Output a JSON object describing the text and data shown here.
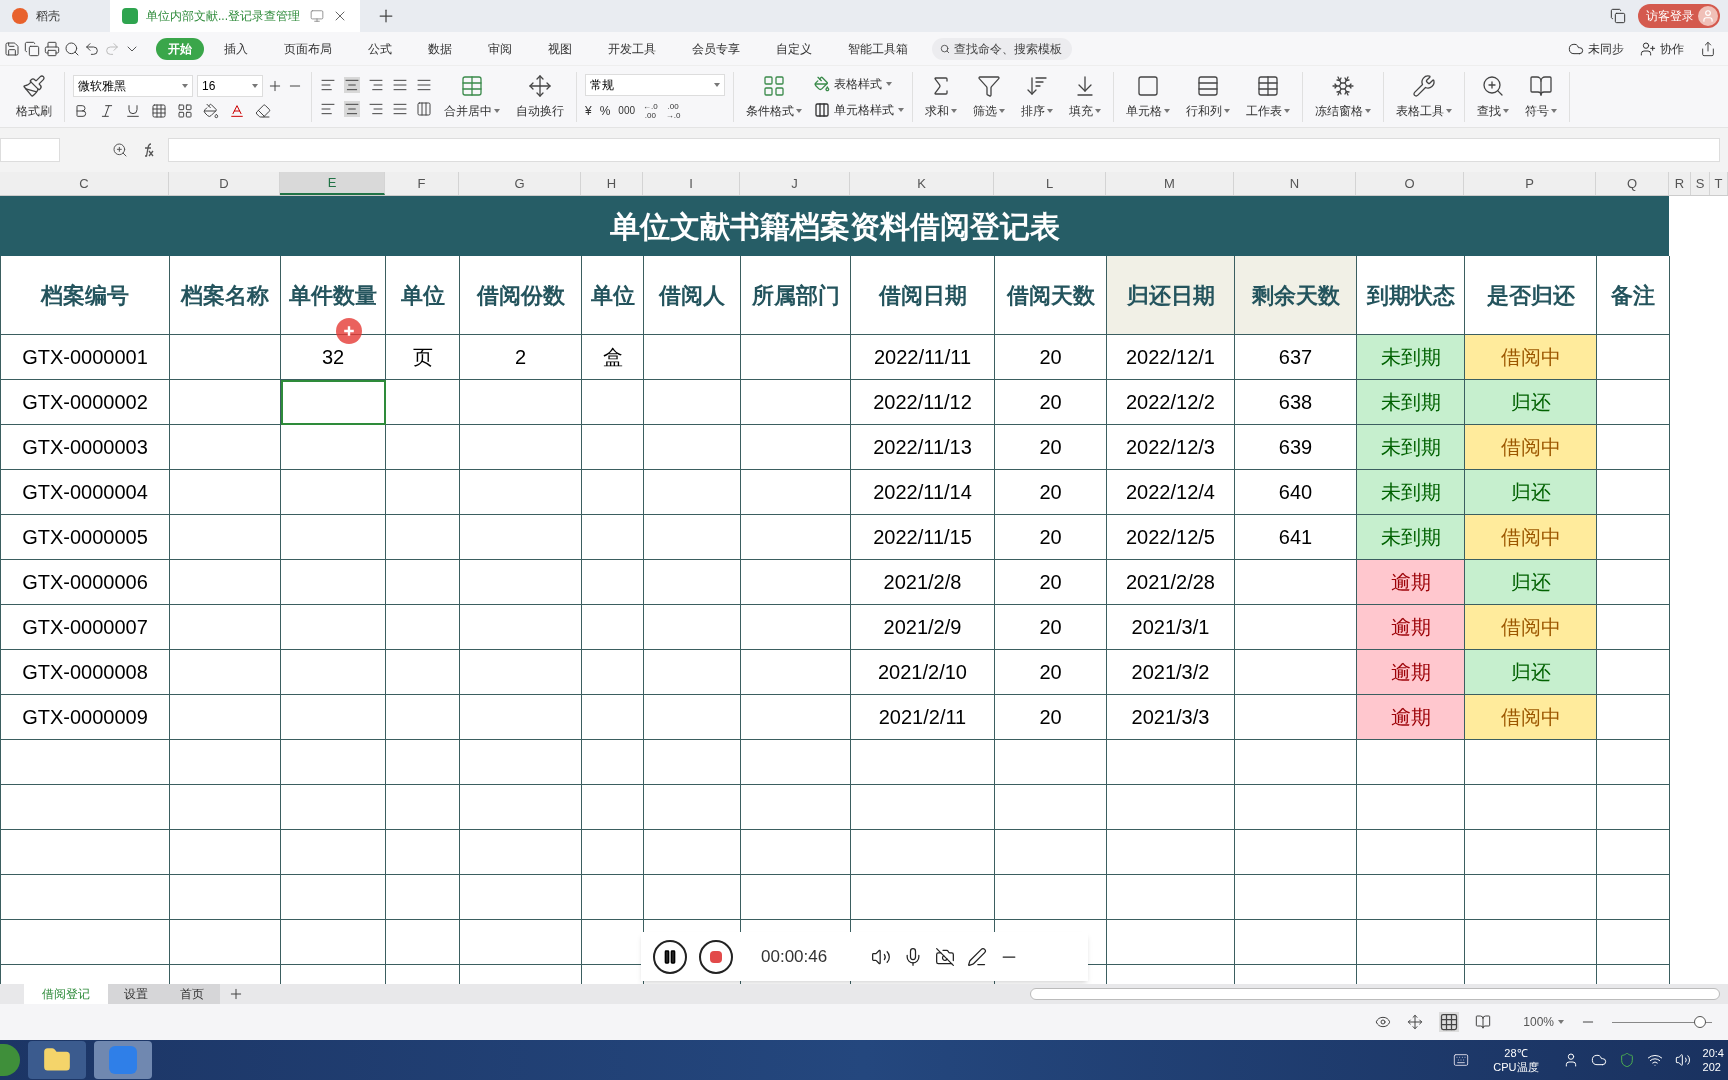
{
  "tabs": [
    {
      "label": "稻壳",
      "selected": false
    },
    {
      "label": "单位内部文献...登记录查管理",
      "selected": true
    }
  ],
  "account": {
    "label": "访客登录"
  },
  "menu": [
    {
      "label": "开始",
      "selected": true
    },
    {
      "label": "插入",
      "selected": false
    },
    {
      "label": "页面布局",
      "selected": false
    },
    {
      "label": "公式",
      "selected": false
    },
    {
      "label": "数据",
      "selected": false
    },
    {
      "label": "审阅",
      "selected": false
    },
    {
      "label": "视图",
      "selected": false
    },
    {
      "label": "开发工具",
      "selected": false
    },
    {
      "label": "会员专享",
      "selected": false
    },
    {
      "label": "自定义",
      "selected": false
    },
    {
      "label": "智能工具箱",
      "selected": false
    }
  ],
  "search": {
    "placeholder": "查找命令、搜索模板"
  },
  "menu_right": [
    "未同步",
    "协作"
  ],
  "toolbar": {
    "format_painter": "格式刷",
    "font": "微软雅黑",
    "font_size": "16",
    "merge": "合并居中",
    "wrap": "自动换行",
    "number_format": "常规",
    "currency": "¥",
    "percent": "%",
    "thousands": "000",
    "decimal_more": [
      "←.0",
      ".00"
    ],
    "decimal_less": [
      ".00",
      "→.0"
    ],
    "conditional": "条件格式",
    "styles": [
      "表格样式",
      "单元格样式"
    ],
    "large": [
      "求和",
      "筛选",
      "排序",
      "填充",
      "单元格",
      "行和列",
      "工作表",
      "冻结窗格",
      "表格工具",
      "查找",
      "符号"
    ]
  },
  "columns": [
    {
      "label": "C",
      "selected": false
    },
    {
      "label": "D",
      "selected": false
    },
    {
      "label": "E",
      "selected": true
    },
    {
      "label": "F",
      "selected": false
    },
    {
      "label": "G",
      "selected": false
    },
    {
      "label": "H",
      "selected": false
    },
    {
      "label": "I",
      "selected": false
    },
    {
      "label": "J",
      "selected": false
    },
    {
      "label": "K",
      "selected": false
    },
    {
      "label": "L",
      "selected": false
    },
    {
      "label": "M",
      "selected": false
    },
    {
      "label": "N",
      "selected": false
    },
    {
      "label": "O",
      "selected": false
    },
    {
      "label": "P",
      "selected": false
    },
    {
      "label": "Q",
      "selected": false
    },
    {
      "label": "R",
      "selected": false
    },
    {
      "label": "S",
      "selected": false
    },
    {
      "label": "T",
      "selected": false
    }
  ],
  "sheet_title": "单位文献书籍档案资料借阅登记表",
  "headers": [
    {
      "label": "档案编号",
      "shaded": false
    },
    {
      "label": "档案名称",
      "shaded": false
    },
    {
      "label": "单件数量",
      "shaded": false
    },
    {
      "label": "单位",
      "shaded": false
    },
    {
      "label": "借阅份数",
      "shaded": false
    },
    {
      "label": "单位",
      "shaded": false
    },
    {
      "label": "借阅人",
      "shaded": false
    },
    {
      "label": "所属部门",
      "shaded": false
    },
    {
      "label": "借阅日期",
      "shaded": false
    },
    {
      "label": "借阅天数",
      "shaded": false
    },
    {
      "label": "归还日期",
      "shaded": true
    },
    {
      "label": "剩余天数",
      "shaded": true
    },
    {
      "label": "到期状态",
      "shaded": false
    },
    {
      "label": "是否归还",
      "shaded": false
    },
    {
      "label": "备注",
      "shaded": false
    }
  ],
  "rows": [
    {
      "id": "GTX-0000001",
      "quantity": "32",
      "unit": "页",
      "copies": "2",
      "package": "盒",
      "borrow_date": "2022/11/11",
      "days": "20",
      "return_date": "2022/12/1",
      "remaining_days": "637",
      "due_status": {
        "text": "未到期",
        "kind": "not_due"
      },
      "return_status": {
        "text": "借阅中",
        "kind": "borrowing"
      },
      "quantity_selected": false
    },
    {
      "id": "GTX-0000002",
      "borrow_date": "2022/11/12",
      "days": "20",
      "return_date": "2022/12/2",
      "remaining_days": "638",
      "due_status": {
        "text": "未到期",
        "kind": "not_due"
      },
      "return_status": {
        "text": "归还",
        "kind": "returned"
      },
      "quantity_selected": true
    },
    {
      "id": "GTX-0000003",
      "borrow_date": "2022/11/13",
      "days": "20",
      "return_date": "2022/12/3",
      "remaining_days": "639",
      "due_status": {
        "text": "未到期",
        "kind": "not_due"
      },
      "return_status": {
        "text": "借阅中",
        "kind": "borrowing"
      },
      "quantity_selected": false
    },
    {
      "id": "GTX-0000004",
      "borrow_date": "2022/11/14",
      "days": "20",
      "return_date": "2022/12/4",
      "remaining_days": "640",
      "due_status": {
        "text": "未到期",
        "kind": "not_due"
      },
      "return_status": {
        "text": "归还",
        "kind": "returned"
      },
      "quantity_selected": false
    },
    {
      "id": "GTX-0000005",
      "borrow_date": "2022/11/15",
      "days": "20",
      "return_date": "2022/12/5",
      "remaining_days": "641",
      "due_status": {
        "text": "未到期",
        "kind": "not_due"
      },
      "return_status": {
        "text": "借阅中",
        "kind": "borrowing"
      },
      "quantity_selected": false
    },
    {
      "id": "GTX-0000006",
      "borrow_date": "2021/2/8",
      "days": "20",
      "return_date": "2021/2/28",
      "due_status": {
        "text": "逾期",
        "kind": "overdue"
      },
      "return_status": {
        "text": "归还",
        "kind": "returned"
      },
      "quantity_selected": false
    },
    {
      "id": "GTX-0000007",
      "borrow_date": "2021/2/9",
      "days": "20",
      "return_date": "2021/3/1",
      "due_status": {
        "text": "逾期",
        "kind": "overdue"
      },
      "return_status": {
        "text": "借阅中",
        "kind": "borrowing"
      },
      "quantity_selected": false
    },
    {
      "id": "GTX-0000008",
      "borrow_date": "2021/2/10",
      "days": "20",
      "return_date": "2021/3/2",
      "due_status": {
        "text": "逾期",
        "kind": "overdue"
      },
      "return_status": {
        "text": "归还",
        "kind": "returned"
      },
      "quantity_selected": false
    },
    {
      "id": "GTX-0000009",
      "borrow_date": "2021/2/11",
      "days": "20",
      "return_date": "2021/3/3",
      "due_status": {
        "text": "逾期",
        "kind": "overdue"
      },
      "return_status": {
        "text": "借阅中",
        "kind": "borrowing"
      },
      "quantity_selected": false
    }
  ],
  "recorder": {
    "time": "00:00:46"
  },
  "sheets": [
    {
      "label": "借阅登记",
      "selected": true
    },
    {
      "label": "设置",
      "selected": false
    },
    {
      "label": "首页",
      "selected": false
    }
  ],
  "status_bar": {
    "zoom": "100%",
    "zoom_slider": {
      "level": 0.88
    }
  },
  "taskbar": {
    "temperature": "28℃",
    "sensor": "CPU温度",
    "time": "20:4",
    "date": "202"
  }
}
